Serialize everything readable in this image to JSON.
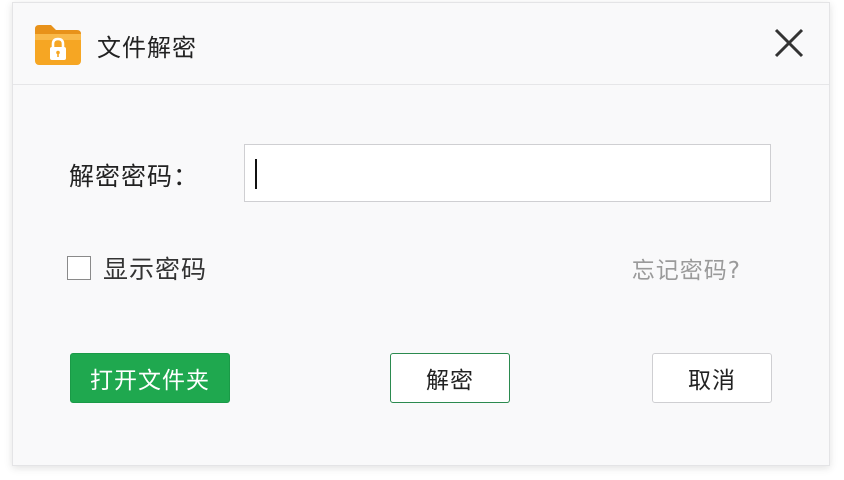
{
  "window": {
    "title": "文件解密",
    "app_icon": "lock-folder-icon",
    "close_icon": "close-icon"
  },
  "form": {
    "password_label": "解密密码：",
    "password_value": "",
    "show_password_label": "显示密码",
    "show_password_checked": false,
    "forgot_password_link": "忘记密码?"
  },
  "buttons": {
    "open_folder": "打开文件夹",
    "decrypt": "解密",
    "cancel": "取消"
  },
  "colors": {
    "primary_green": "#1fa84f",
    "folder_orange": "#f5a623",
    "link_gray": "#9a9a9a"
  }
}
